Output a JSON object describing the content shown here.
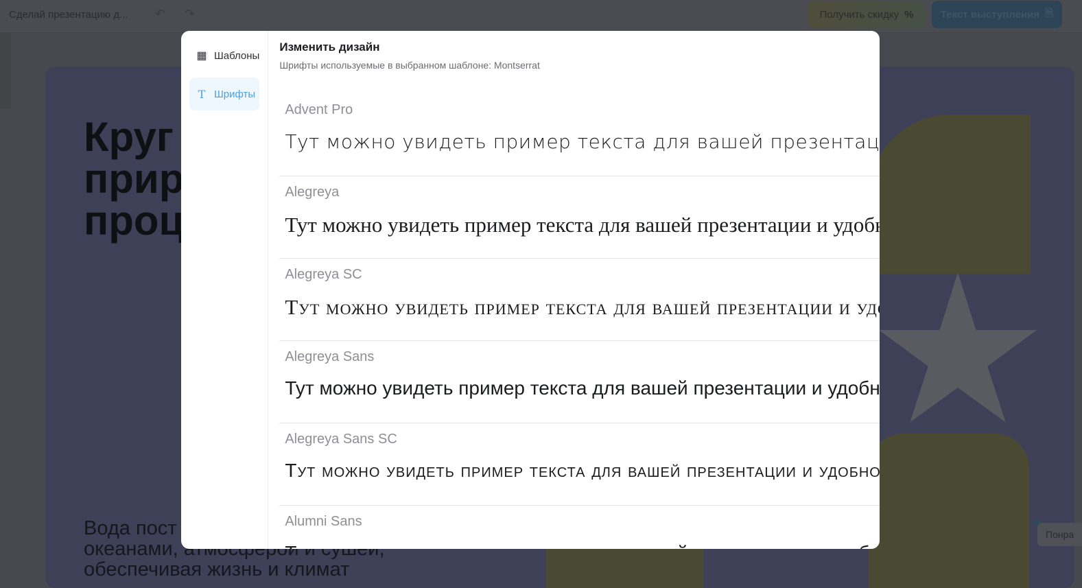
{
  "topbar": {
    "doc_title": "Сделай презентацию д...",
    "discount_label": "Получить скидку",
    "discount_icon": "%",
    "speech_label": "Текст выступления"
  },
  "slide": {
    "title_lines": [
      "Круг",
      "прир",
      "проц"
    ],
    "body_lines": [
      "Вода пост",
      "океанами, атмосферой и сушей,",
      "обеспечивая жизнь и климат"
    ],
    "like_label": "Понра"
  },
  "modal": {
    "title": "Изменить дизайн",
    "subtitle": "Шрифты используемые в выбранном шаблоне: Montserrat",
    "close": "×",
    "sidebar": [
      {
        "label": "Шаблоны",
        "icon": "layout-icon"
      },
      {
        "label": "Шрифты",
        "icon": "text-icon",
        "active": true
      }
    ],
    "sample_text": "Тут можно увидеть пример текста для вашей презентации и удобно выбрать шрифт",
    "fonts": [
      "Advent Pro",
      "Alegreya",
      "Alegreya SC",
      "Alegreya Sans",
      "Alegreya Sans SC",
      "Alumni Sans"
    ]
  }
}
